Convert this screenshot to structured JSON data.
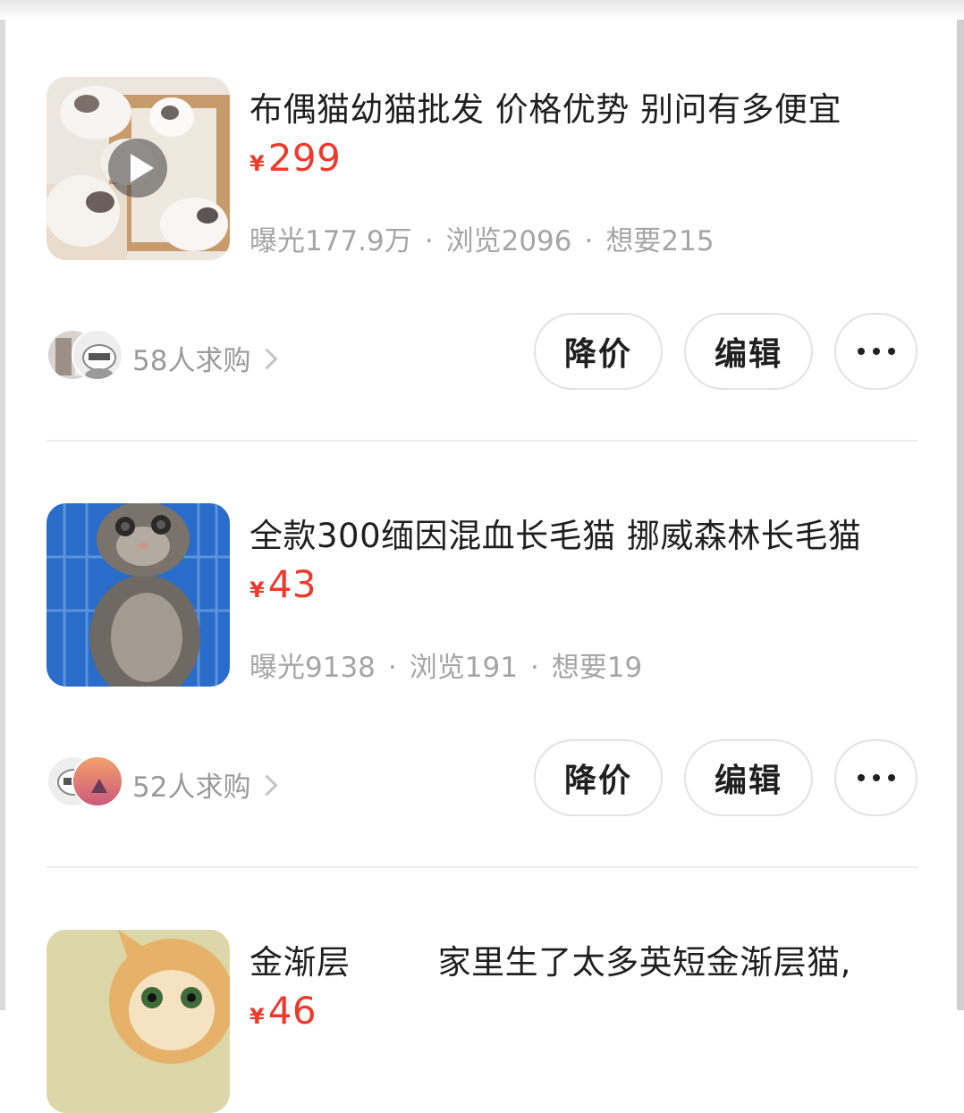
{
  "listings": [
    {
      "title": "布偶猫幼猫批发 价格优势 别问有多便宜",
      "currency": "¥",
      "price": "299",
      "exposure": "曝光177.9万",
      "views": "浏览2096",
      "wants": "想要215",
      "buyers": "58人求购",
      "has_video": true
    },
    {
      "title": "全款300缅因混血长毛猫 挪威森林长毛猫",
      "currency": "¥",
      "price": "43",
      "exposure": "曝光9138",
      "views": "浏览191",
      "wants": "想要19",
      "buyers": "52人求购",
      "has_video": false
    },
    {
      "title": "金渐层        家里生了太多英短金渐层猫,",
      "currency": "¥",
      "price": "46"
    }
  ],
  "actions": {
    "lower_price": "降价",
    "edit": "编辑"
  },
  "separator": "·",
  "colors": {
    "price": "#ee3a2c",
    "stats": "#a5a5a5",
    "title": "#1f1f1f",
    "button_border": "#e2e2e2"
  },
  "icons": [
    "play-icon",
    "chevron-right-icon",
    "more-dots-icon"
  ]
}
